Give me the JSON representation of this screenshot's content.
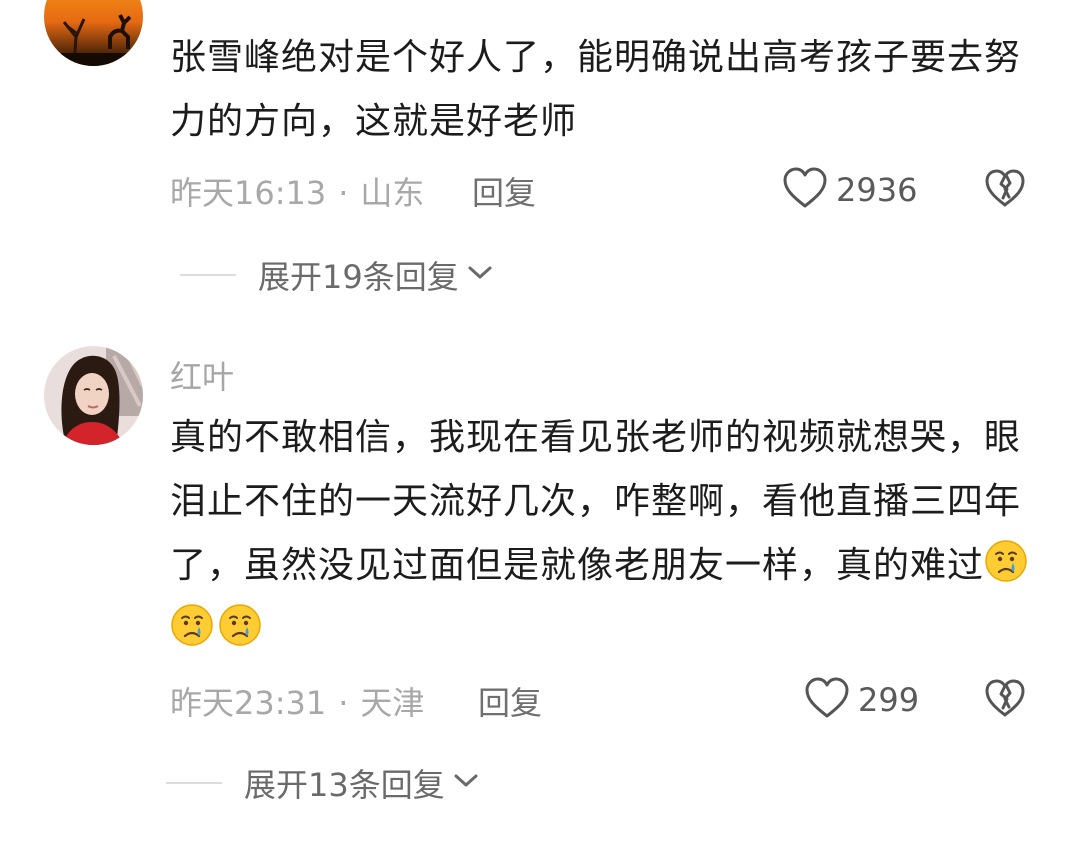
{
  "comments": [
    {
      "username": "",
      "text": "张雪峰绝对是个好人了，能明确说出高考孩子要去努力的方向，这就是好老师",
      "time": "昨天16:13",
      "location": "山东",
      "reply_label": "回复",
      "likes": "2936",
      "expand_label": "展开19条回复"
    },
    {
      "username": "红叶",
      "text": "真的不敢相信，我现在看见张老师的视频就想哭，眼泪止不住的一天流好几次，咋整啊，看他直播三四年了，虽然没见过面但是就像老朋友一样，真的难过",
      "emoji": [
        "crying-face-emoji",
        "crying-face-emoji",
        "crying-face-emoji"
      ],
      "time": "昨天23:31",
      "location": "天津",
      "reply_label": "回复",
      "likes": "299",
      "expand_label": "展开13条回复"
    }
  ],
  "meta_separator": "·",
  "icons": {
    "like": "heart-outline-icon",
    "dislike": "broken-heart-icon",
    "expand": "chevron-down-icon"
  },
  "colors": {
    "text": "#1c1c1c",
    "muted": "#a8a8a8",
    "action": "#6f6f6f"
  }
}
